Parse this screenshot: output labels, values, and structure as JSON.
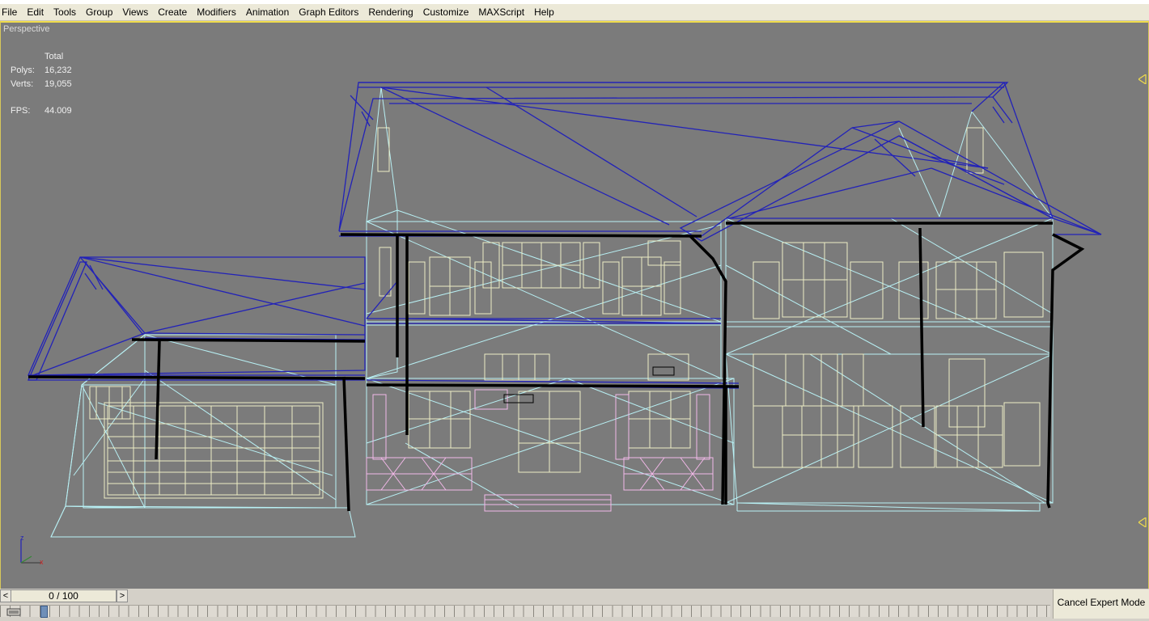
{
  "menubar": {
    "items": [
      "File",
      "Edit",
      "Tools",
      "Group",
      "Views",
      "Create",
      "Modifiers",
      "Animation",
      "Graph Editors",
      "Rendering",
      "Customize",
      "MAXScript",
      "Help"
    ]
  },
  "viewport": {
    "label": "Perspective",
    "stats": {
      "header": "Total",
      "polys_label": "Polys:",
      "polys_value": "16,232",
      "verts_label": "Verts:",
      "verts_value": "19,055",
      "fps_label": "FPS:",
      "fps_value": "44.009"
    },
    "axis": {
      "z": "z",
      "x": "x"
    }
  },
  "timebar": {
    "prev": "<",
    "frame": "0 / 100",
    "next": ">",
    "cancel_expert": "Cancel Expert Mode"
  },
  "colors": {
    "viewport_bg": "#7b7b7b",
    "roof": "#2222b8",
    "wall": "#b8f0f4",
    "window": "#eeeec4",
    "porch": "#f2b8e8",
    "gutter": "#000000",
    "viewport_border": "#f0dc4c"
  },
  "icons": [
    "viewport-axis-icon",
    "side-marker-icon",
    "filter-icon"
  ]
}
